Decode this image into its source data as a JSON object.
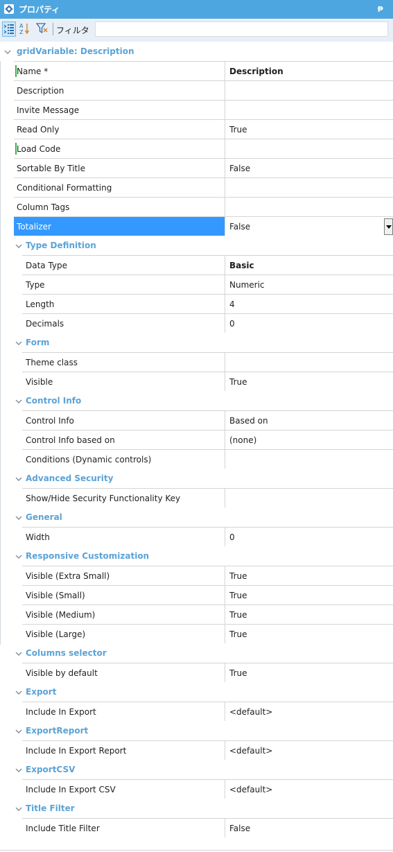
{
  "window": {
    "title": "プロパティ",
    "pin_glyph": "ᵽ"
  },
  "toolbar": {
    "filter_label": "フィルタ",
    "filter_value": "",
    "icons": [
      "categorized-icon",
      "sort-az-icon",
      "filter-funnel-icon"
    ]
  },
  "root": {
    "title": "gridVariable: Description"
  },
  "main_rows": [
    {
      "name": "Name *",
      "value": "Description",
      "bold": true,
      "marker": true
    },
    {
      "name": "Description",
      "value": ""
    },
    {
      "name": "Invite Message",
      "value": ""
    },
    {
      "name": "Read Only",
      "value": "True"
    },
    {
      "name": "Load Code",
      "value": "",
      "marker": true
    },
    {
      "name": "Sortable By Title",
      "value": "False"
    },
    {
      "name": "Conditional Formatting",
      "value": ""
    },
    {
      "name": "Column Tags",
      "value": ""
    },
    {
      "name": "Totalizer",
      "value": "False",
      "selected": true
    }
  ],
  "sections": [
    {
      "title": "Type Definition",
      "rows": [
        {
          "name": "Data Type",
          "value": "Basic",
          "bold": true
        },
        {
          "name": "Type",
          "value": "Numeric"
        },
        {
          "name": "Length",
          "value": "4"
        },
        {
          "name": "Decimals",
          "value": "0"
        }
      ]
    },
    {
      "title": "Form",
      "rows": [
        {
          "name": "Theme class",
          "value": ""
        },
        {
          "name": "Visible",
          "value": "True"
        }
      ]
    },
    {
      "title": "Control Info",
      "rows": [
        {
          "name": "Control Info",
          "value": "Based on"
        },
        {
          "name": "Control Info based on",
          "value": "(none)"
        },
        {
          "name": "Conditions (Dynamic controls)",
          "value": ""
        }
      ]
    },
    {
      "title": "Advanced Security",
      "rows": [
        {
          "name": "Show/Hide Security Functionality Key",
          "value": ""
        }
      ]
    },
    {
      "title": "General",
      "rows": [
        {
          "name": "Width",
          "value": "0"
        }
      ]
    },
    {
      "title": "Responsive Customization",
      "rows": [
        {
          "name": "Visible (Extra Small)",
          "value": "True"
        },
        {
          "name": "Visible (Small)",
          "value": "True"
        },
        {
          "name": "Visible (Medium)",
          "value": "True"
        },
        {
          "name": "Visible (Large)",
          "value": "True"
        }
      ]
    },
    {
      "title": "Columns selector",
      "rows": [
        {
          "name": "Visible by default",
          "value": "True"
        }
      ]
    },
    {
      "title": "Export",
      "rows": [
        {
          "name": "Include In Export",
          "value": "<default>"
        }
      ]
    },
    {
      "title": "ExportReport",
      "rows": [
        {
          "name": "Include In Export Report",
          "value": "<default>"
        }
      ]
    },
    {
      "title": "ExportCSV",
      "rows": [
        {
          "name": "Include In Export CSV",
          "value": "<default>"
        }
      ]
    },
    {
      "title": "Title Filter",
      "rows": [
        {
          "name": "Include Title Filter",
          "value": "False"
        }
      ]
    }
  ],
  "colors": {
    "titlebar": "#4ea6e0",
    "category_text": "#5ba3d6",
    "selection": "#3399ff",
    "modified_marker": "#3cb043"
  }
}
